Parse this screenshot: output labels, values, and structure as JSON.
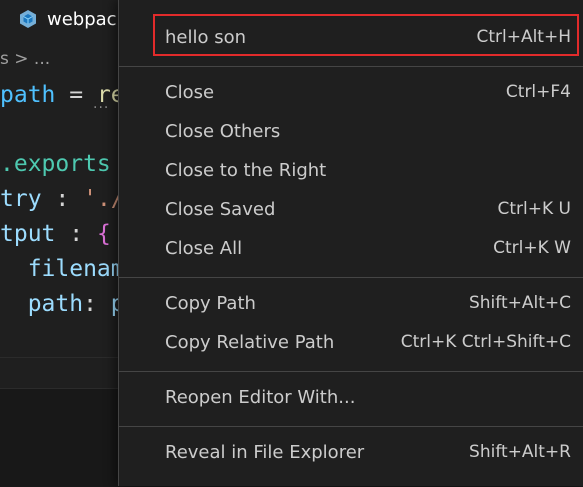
{
  "tab": {
    "label": "webpack",
    "icon": "webpack-cube-icon"
  },
  "breadcrumb": {
    "text": "s > ..."
  },
  "code": {
    "line1": {
      "a": "path",
      "b": " = ",
      "c": "re"
    },
    "line2": {
      "a": ".exports"
    },
    "line3": {
      "a": "try",
      "b": " : ",
      "c": "'./"
    },
    "line4": {
      "a": "tput",
      "b": " : ",
      "c": "{"
    },
    "line5": {
      "a": "  filename"
    },
    "line6": {
      "a": "  path",
      "b": ": ",
      "c": "pa"
    }
  },
  "menu": {
    "items": [
      {
        "label": "hello son",
        "shortcut": "Ctrl+Alt+H"
      },
      {
        "label": "Close",
        "shortcut": "Ctrl+F4"
      },
      {
        "label": "Close Others",
        "shortcut": ""
      },
      {
        "label": "Close to the Right",
        "shortcut": ""
      },
      {
        "label": "Close Saved",
        "shortcut": "Ctrl+K U"
      },
      {
        "label": "Close All",
        "shortcut": "Ctrl+K W"
      },
      {
        "label": "Copy Path",
        "shortcut": "Shift+Alt+C"
      },
      {
        "label": "Copy Relative Path",
        "shortcut": "Ctrl+K Ctrl+Shift+C"
      },
      {
        "label": "Reopen Editor With...",
        "shortcut": ""
      },
      {
        "label": "Reveal in File Explorer",
        "shortcut": "Shift+Alt+R"
      }
    ]
  },
  "colors": {
    "highlight_border": "#e22b2b",
    "menu_bg": "#1f1f1f",
    "menu_text": "#cccccc"
  }
}
